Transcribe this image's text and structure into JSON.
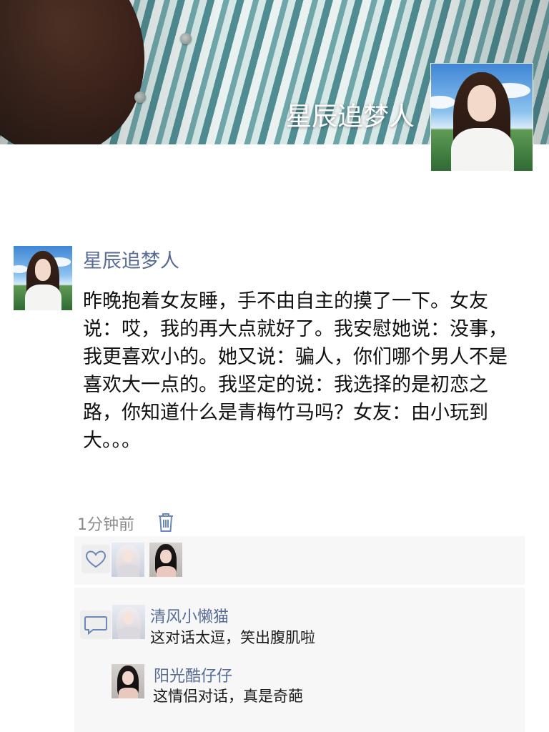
{
  "profile": {
    "cover_name": "星辰追梦人"
  },
  "post": {
    "author": "星辰追梦人",
    "content": "昨晚抱着女友睡，手不由自主的摸了一下。女友说：哎，我的再大点就好了。我安慰她说：没事，我更喜欢小的。她又说：骗人，你们哪个男人不是喜欢大一点的。我坚定的说：我选择的是初恋之路，你知道什么是青梅竹马吗？女友：由小玩到大。。。",
    "time": "1分钟前",
    "delete_icon": "trash-icon"
  },
  "likes": {
    "icon": "heart-icon",
    "avatars": [
      "avatar-silver-hair",
      "avatar-black-hair"
    ]
  },
  "comments": {
    "icon": "comment-icon",
    "items": [
      {
        "author": "清风小懒猫",
        "text": "这对话太逗，笑出腹肌啦"
      },
      {
        "author": "阳光酷仔仔",
        "text": "这情侣对话，真是奇葩"
      }
    ]
  },
  "colors": {
    "name_blue": "#576b95",
    "panel_gray": "#f7f7f7",
    "text": "#111111",
    "time_gray": "#8a8a8a"
  }
}
